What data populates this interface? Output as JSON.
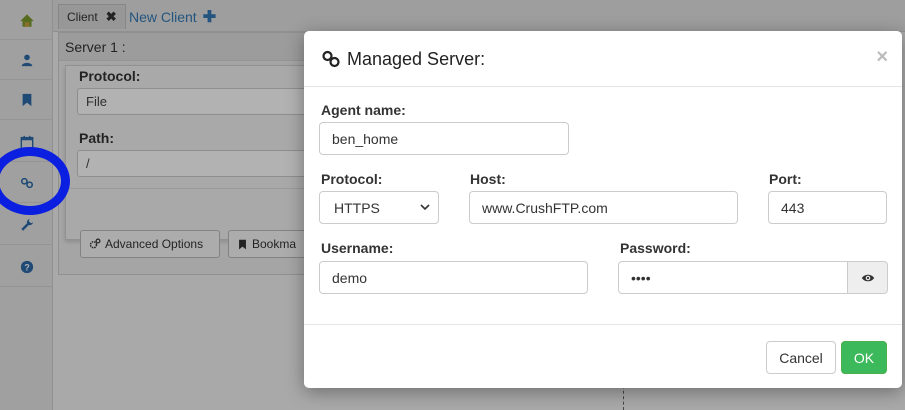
{
  "tabs": {
    "client_label": "Client",
    "close_glyph": "✖",
    "new_client_label": "New Client",
    "plus_glyph": "✚"
  },
  "server_panel": {
    "title": "Server 1 :",
    "protocol_label": "Protocol:",
    "protocol_value": "File",
    "path_label": "Path:",
    "path_value": "/",
    "advanced_options_label": "Advanced Options",
    "bookmark_label": "Bookma"
  },
  "sidebar": {
    "items": [
      {
        "icon": "home-icon"
      },
      {
        "icon": "user-icon"
      },
      {
        "icon": "bookmark-icon"
      },
      {
        "icon": "calendar-icon"
      },
      {
        "icon": "link-icon"
      },
      {
        "icon": "wrench-icon"
      },
      {
        "icon": "question-icon"
      }
    ]
  },
  "modal": {
    "title": "Managed Server:",
    "close_glyph": "×",
    "agent_name_label": "Agent name:",
    "agent_name_value": "ben_home",
    "protocol_label": "Protocol:",
    "protocol_value": "HTTPS",
    "host_label": "Host:",
    "host_value": "www.CrushFTP.com",
    "port_label": "Port:",
    "port_value": "443",
    "username_label": "Username:",
    "username_value": "demo",
    "password_label": "Password:",
    "password_value": "••••",
    "cancel_label": "Cancel",
    "ok_label": "OK"
  },
  "colors": {
    "accent_blue": "#337ab7",
    "ok_green": "#3cb95a",
    "highlight_ring": "#0b1fe0"
  }
}
